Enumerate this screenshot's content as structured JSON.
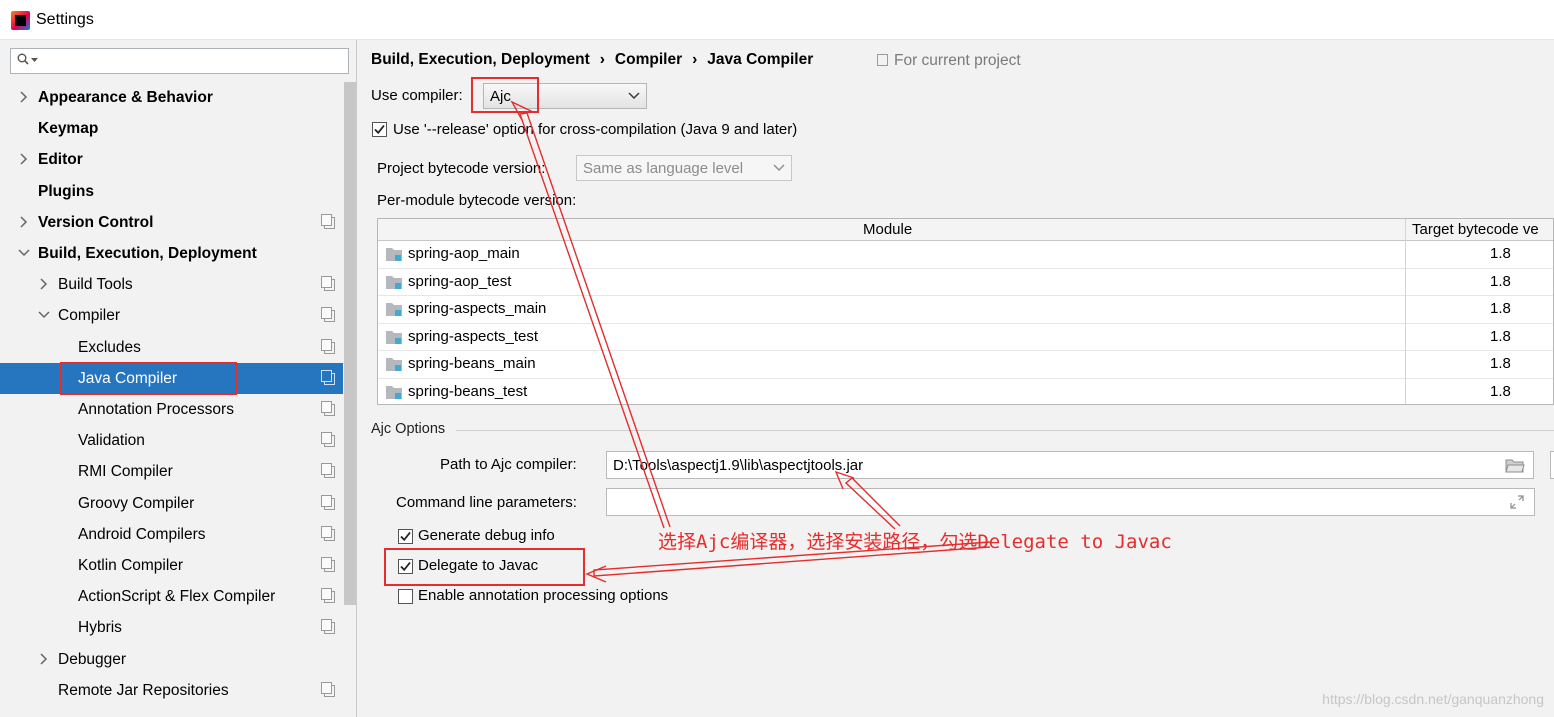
{
  "window": {
    "title": "Settings",
    "logo_letters": "IJ"
  },
  "sidebar": {
    "search_placeholder": "",
    "items": [
      {
        "label": "Appearance & Behavior",
        "expander": "collapsed",
        "bold": true,
        "project_scoped": false
      },
      {
        "label": "Keymap",
        "expander": "none",
        "bold": true,
        "project_scoped": false
      },
      {
        "label": "Editor",
        "expander": "collapsed",
        "bold": true,
        "project_scoped": false
      },
      {
        "label": "Plugins",
        "expander": "none",
        "bold": true,
        "project_scoped": false
      },
      {
        "label": "Version Control",
        "expander": "collapsed",
        "bold": true,
        "project_scoped": true
      },
      {
        "label": "Build, Execution, Deployment",
        "expander": "expanded",
        "bold": true,
        "project_scoped": false
      },
      {
        "label": "Build Tools",
        "expander": "collapsed",
        "bold": false,
        "project_scoped": true
      },
      {
        "label": "Compiler",
        "expander": "expanded",
        "bold": false,
        "project_scoped": true
      },
      {
        "label": "Excludes",
        "expander": "none",
        "bold": false,
        "project_scoped": true
      },
      {
        "label": "Java Compiler",
        "expander": "none",
        "bold": false,
        "project_scoped": true,
        "selected": true
      },
      {
        "label": "Annotation Processors",
        "expander": "none",
        "bold": false,
        "project_scoped": true
      },
      {
        "label": "Validation",
        "expander": "none",
        "bold": false,
        "project_scoped": true
      },
      {
        "label": "RMI Compiler",
        "expander": "none",
        "bold": false,
        "project_scoped": true
      },
      {
        "label": "Groovy Compiler",
        "expander": "none",
        "bold": false,
        "project_scoped": true
      },
      {
        "label": "Android Compilers",
        "expander": "none",
        "bold": false,
        "project_scoped": true
      },
      {
        "label": "Kotlin Compiler",
        "expander": "none",
        "bold": false,
        "project_scoped": true
      },
      {
        "label": "ActionScript & Flex Compiler",
        "expander": "none",
        "bold": false,
        "project_scoped": true
      },
      {
        "label": "Hybris",
        "expander": "none",
        "bold": false,
        "project_scoped": true
      },
      {
        "label": "Debugger",
        "expander": "collapsed",
        "bold": false,
        "project_scoped": false
      },
      {
        "label": "Remote Jar Repositories",
        "expander": "none",
        "bold": false,
        "project_scoped": true
      }
    ]
  },
  "main": {
    "breadcrumb": [
      "Build, Execution, Deployment",
      "Compiler",
      "Java Compiler"
    ],
    "breadcrumb_separator": "›",
    "scope_label": "For current project",
    "use_compiler_label": "Use compiler:",
    "use_compiler_value": "Ajc",
    "release_option_label": "Use '--release' option for cross-compilation (Java 9 and later)",
    "release_option_checked": true,
    "project_bytecode_label": "Project bytecode version:",
    "project_bytecode_value": "Same as language level",
    "per_module_label": "Per-module bytecode version:",
    "table": {
      "columns": [
        "Module",
        "Target bytecode ve"
      ],
      "rows": [
        {
          "module": "spring-aop_main",
          "target": "1.8"
        },
        {
          "module": "spring-aop_test",
          "target": "1.8"
        },
        {
          "module": "spring-aspects_main",
          "target": "1.8"
        },
        {
          "module": "spring-aspects_test",
          "target": "1.8"
        },
        {
          "module": "spring-beans_main",
          "target": "1.8"
        },
        {
          "module": "spring-beans_test",
          "target": "1.8"
        }
      ]
    },
    "ajc": {
      "section_title": "Ajc Options",
      "path_label": "Path to Ajc compiler:",
      "path_value": "D:\\Tools\\aspectj1.9\\lib\\aspectjtools.jar",
      "cmd_label": "Command line parameters:",
      "cmd_value": "",
      "generate_debug_label": "Generate debug info",
      "generate_debug_checked": true,
      "delegate_label": "Delegate to Javac",
      "delegate_checked": true,
      "annotation_label": "Enable annotation processing options",
      "annotation_checked": false
    }
  },
  "annotation_text": "选择Ajc编译器，选择安装路径，勾选Delegate to Javac",
  "watermark": "https://blog.csdn.net/ganquanzhong",
  "colors": {
    "selection": "#2675bf",
    "annotation_red": "#e52d2d",
    "folder_blue": "#40a9d6"
  }
}
